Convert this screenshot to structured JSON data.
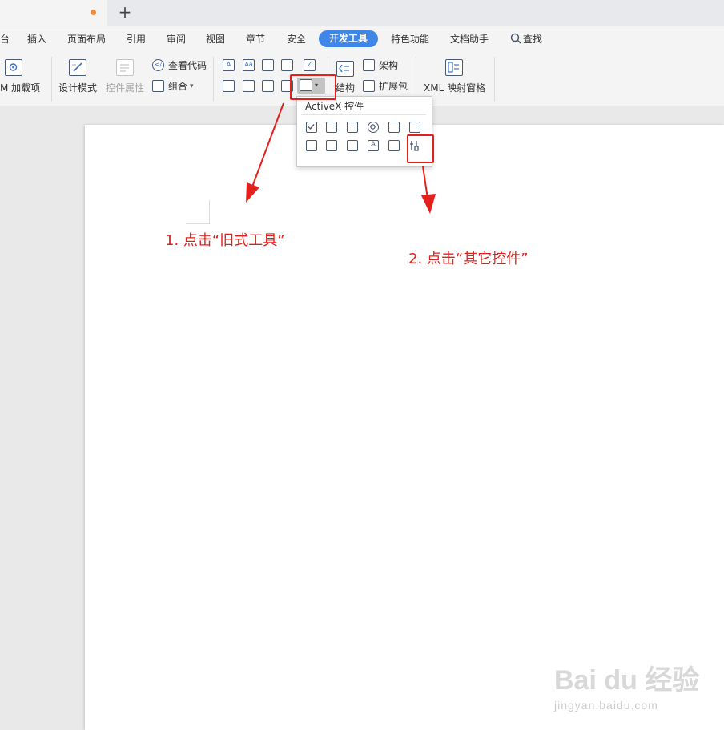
{
  "titlebar": {
    "new_tab": "+"
  },
  "menu": {
    "items": [
      "台",
      "插入",
      "页面布局",
      "引用",
      "审阅",
      "视图",
      "章节",
      "安全",
      "开发工具",
      "特色功能",
      "文档助手",
      "查找"
    ],
    "active": "开发工具"
  },
  "ribbon": {
    "com_addins": "M 加载项",
    "design_mode": "设计模式",
    "control_props": "控件属性",
    "view_code": "查看代码",
    "group": "组合",
    "structure_part": "结构",
    "schema": "架构",
    "expansion_pack": "扩展包",
    "xml_pane": "XML 映射窗格",
    "dropdown_caret": "▾"
  },
  "popup": {
    "title": "ActiveX 控件"
  },
  "annotations": {
    "step1": "1. 点击“旧式工具”",
    "step2": "2. 点击“其它控件”"
  },
  "watermark": {
    "logo": "Bai du 经验",
    "url": "jingyan.baidu.com"
  },
  "colors": {
    "accent": "#3e86e8",
    "annotation": "#e3201b",
    "tab_dot": "#f08c3c"
  }
}
